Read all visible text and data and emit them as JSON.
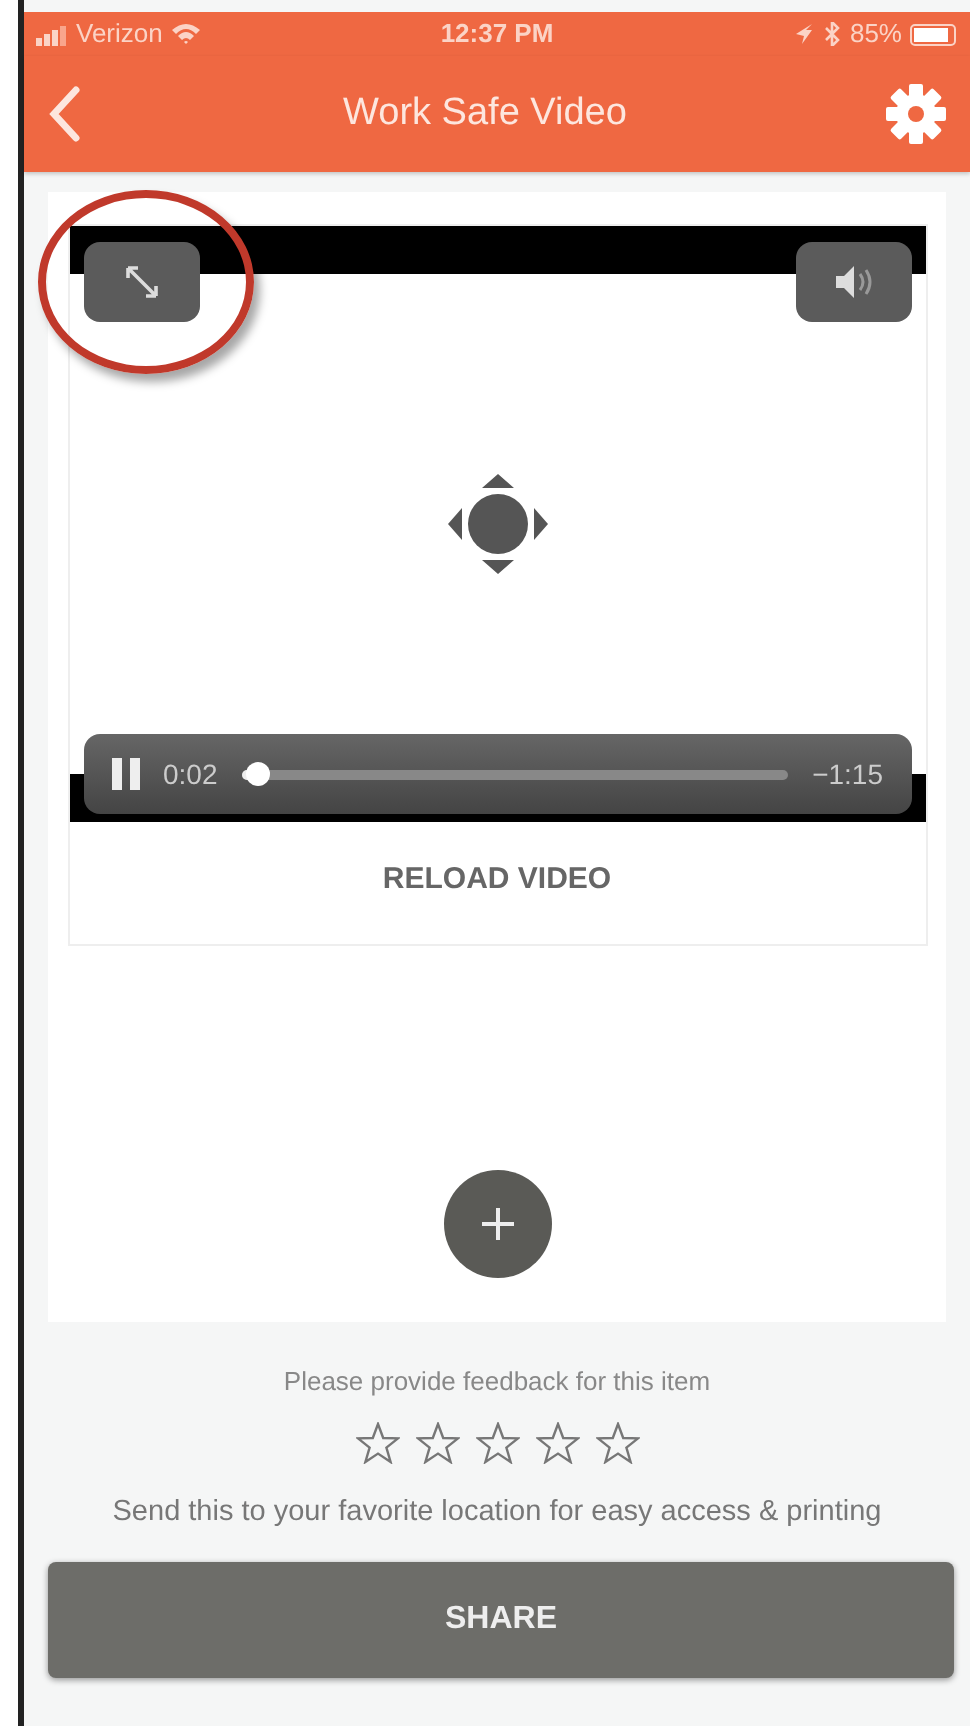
{
  "status_bar": {
    "carrier": "Verizon",
    "time": "12:37 PM",
    "battery": "85%"
  },
  "header": {
    "title": "Work Safe Video"
  },
  "video": {
    "playing": true,
    "elapsed": "0:02",
    "remaining": "−1:15",
    "level": 0.03,
    "fullscreen_highlighted": true
  },
  "reload": {
    "label": "RELOAD VIDEO"
  },
  "feedback": {
    "prompt": "Please provide feedback for this item",
    "stars": 0
  },
  "share": {
    "text": "Send this to your favorite location for easy access & printing",
    "button": "SHARE"
  }
}
